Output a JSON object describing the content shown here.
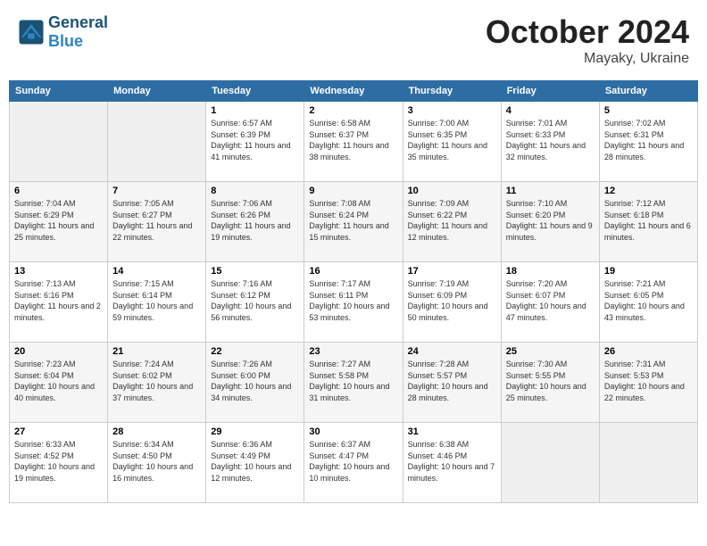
{
  "header": {
    "logo_general": "General",
    "logo_blue": "Blue",
    "month": "October 2024",
    "location": "Mayaky, Ukraine"
  },
  "weekdays": [
    "Sunday",
    "Monday",
    "Tuesday",
    "Wednesday",
    "Thursday",
    "Friday",
    "Saturday"
  ],
  "weeks": [
    [
      {
        "day": "",
        "info": ""
      },
      {
        "day": "",
        "info": ""
      },
      {
        "day": "1",
        "info": "Sunrise: 6:57 AM\nSunset: 6:39 PM\nDaylight: 11 hours and 41 minutes."
      },
      {
        "day": "2",
        "info": "Sunrise: 6:58 AM\nSunset: 6:37 PM\nDaylight: 11 hours and 38 minutes."
      },
      {
        "day": "3",
        "info": "Sunrise: 7:00 AM\nSunset: 6:35 PM\nDaylight: 11 hours and 35 minutes."
      },
      {
        "day": "4",
        "info": "Sunrise: 7:01 AM\nSunset: 6:33 PM\nDaylight: 11 hours and 32 minutes."
      },
      {
        "day": "5",
        "info": "Sunrise: 7:02 AM\nSunset: 6:31 PM\nDaylight: 11 hours and 28 minutes."
      }
    ],
    [
      {
        "day": "6",
        "info": "Sunrise: 7:04 AM\nSunset: 6:29 PM\nDaylight: 11 hours and 25 minutes."
      },
      {
        "day": "7",
        "info": "Sunrise: 7:05 AM\nSunset: 6:27 PM\nDaylight: 11 hours and 22 minutes."
      },
      {
        "day": "8",
        "info": "Sunrise: 7:06 AM\nSunset: 6:26 PM\nDaylight: 11 hours and 19 minutes."
      },
      {
        "day": "9",
        "info": "Sunrise: 7:08 AM\nSunset: 6:24 PM\nDaylight: 11 hours and 15 minutes."
      },
      {
        "day": "10",
        "info": "Sunrise: 7:09 AM\nSunset: 6:22 PM\nDaylight: 11 hours and 12 minutes."
      },
      {
        "day": "11",
        "info": "Sunrise: 7:10 AM\nSunset: 6:20 PM\nDaylight: 11 hours and 9 minutes."
      },
      {
        "day": "12",
        "info": "Sunrise: 7:12 AM\nSunset: 6:18 PM\nDaylight: 11 hours and 6 minutes."
      }
    ],
    [
      {
        "day": "13",
        "info": "Sunrise: 7:13 AM\nSunset: 6:16 PM\nDaylight: 11 hours and 2 minutes."
      },
      {
        "day": "14",
        "info": "Sunrise: 7:15 AM\nSunset: 6:14 PM\nDaylight: 10 hours and 59 minutes."
      },
      {
        "day": "15",
        "info": "Sunrise: 7:16 AM\nSunset: 6:12 PM\nDaylight: 10 hours and 56 minutes."
      },
      {
        "day": "16",
        "info": "Sunrise: 7:17 AM\nSunset: 6:11 PM\nDaylight: 10 hours and 53 minutes."
      },
      {
        "day": "17",
        "info": "Sunrise: 7:19 AM\nSunset: 6:09 PM\nDaylight: 10 hours and 50 minutes."
      },
      {
        "day": "18",
        "info": "Sunrise: 7:20 AM\nSunset: 6:07 PM\nDaylight: 10 hours and 47 minutes."
      },
      {
        "day": "19",
        "info": "Sunrise: 7:21 AM\nSunset: 6:05 PM\nDaylight: 10 hours and 43 minutes."
      }
    ],
    [
      {
        "day": "20",
        "info": "Sunrise: 7:23 AM\nSunset: 6:04 PM\nDaylight: 10 hours and 40 minutes."
      },
      {
        "day": "21",
        "info": "Sunrise: 7:24 AM\nSunset: 6:02 PM\nDaylight: 10 hours and 37 minutes."
      },
      {
        "day": "22",
        "info": "Sunrise: 7:26 AM\nSunset: 6:00 PM\nDaylight: 10 hours and 34 minutes."
      },
      {
        "day": "23",
        "info": "Sunrise: 7:27 AM\nSunset: 5:58 PM\nDaylight: 10 hours and 31 minutes."
      },
      {
        "day": "24",
        "info": "Sunrise: 7:28 AM\nSunset: 5:57 PM\nDaylight: 10 hours and 28 minutes."
      },
      {
        "day": "25",
        "info": "Sunrise: 7:30 AM\nSunset: 5:55 PM\nDaylight: 10 hours and 25 minutes."
      },
      {
        "day": "26",
        "info": "Sunrise: 7:31 AM\nSunset: 5:53 PM\nDaylight: 10 hours and 22 minutes."
      }
    ],
    [
      {
        "day": "27",
        "info": "Sunrise: 6:33 AM\nSunset: 4:52 PM\nDaylight: 10 hours and 19 minutes."
      },
      {
        "day": "28",
        "info": "Sunrise: 6:34 AM\nSunset: 4:50 PM\nDaylight: 10 hours and 16 minutes."
      },
      {
        "day": "29",
        "info": "Sunrise: 6:36 AM\nSunset: 4:49 PM\nDaylight: 10 hours and 12 minutes."
      },
      {
        "day": "30",
        "info": "Sunrise: 6:37 AM\nSunset: 4:47 PM\nDaylight: 10 hours and 10 minutes."
      },
      {
        "day": "31",
        "info": "Sunrise: 6:38 AM\nSunset: 4:46 PM\nDaylight: 10 hours and 7 minutes."
      },
      {
        "day": "",
        "info": ""
      },
      {
        "day": "",
        "info": ""
      }
    ]
  ]
}
